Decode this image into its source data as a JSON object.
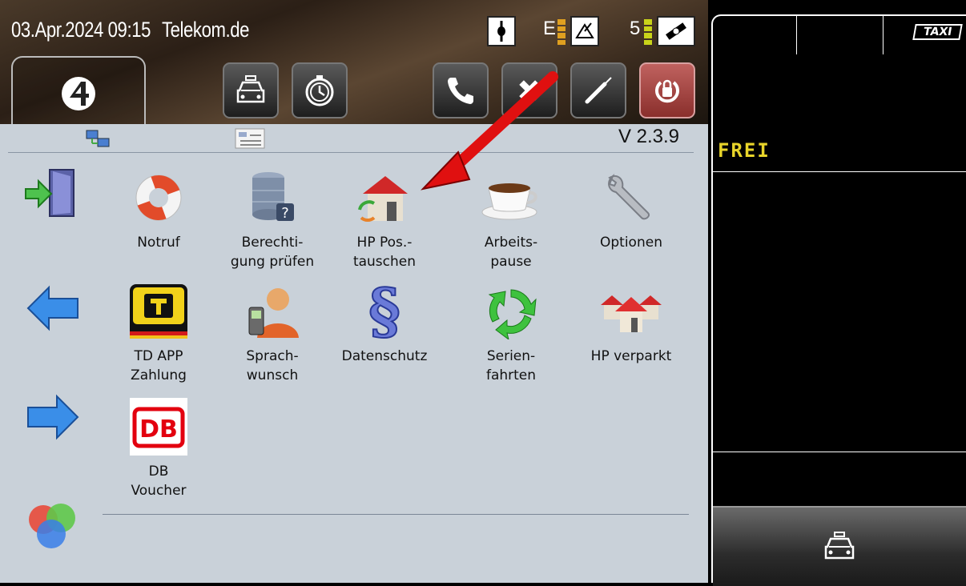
{
  "header": {
    "datetime": "03.Apr.2024 09:15",
    "carrier": "Telekom.de",
    "status_e": "E",
    "status_sat": "5"
  },
  "version": "V 2.3.9",
  "tiles": [
    {
      "label1": "Notruf",
      "label2": "",
      "icon": "lifebuoy-icon"
    },
    {
      "label1": "Berechti-",
      "label2": "gung prüfen",
      "icon": "database-question-icon"
    },
    {
      "label1": "HP Pos.-",
      "label2": "tauschen",
      "icon": "house-swap-icon"
    },
    {
      "label1": "Arbeits-",
      "label2": "pause",
      "icon": "coffee-cup-icon"
    },
    {
      "label1": "Optionen",
      "label2": "",
      "icon": "wrench-icon"
    },
    {
      "label1": "TD APP",
      "label2": "Zahlung",
      "icon": "td-app-icon"
    },
    {
      "label1": "Sprach-",
      "label2": "wunsch",
      "icon": "person-phone-icon"
    },
    {
      "label1": "Datenschutz",
      "label2": "",
      "icon": "paragraph-icon"
    },
    {
      "label1": "Serien-",
      "label2": "fahrten",
      "icon": "recycle-icon"
    },
    {
      "label1": "HP verparkt",
      "label2": "",
      "icon": "houses-icon"
    },
    {
      "label1": "DB",
      "label2": "Voucher",
      "icon": "db-logo-icon"
    }
  ],
  "right_panel": {
    "status": "FREI",
    "badge": "TAXI"
  },
  "colors": {
    "panel_bg": "#c9d1d9",
    "status_text": "#e8d42a",
    "arrow": "#e01010"
  }
}
